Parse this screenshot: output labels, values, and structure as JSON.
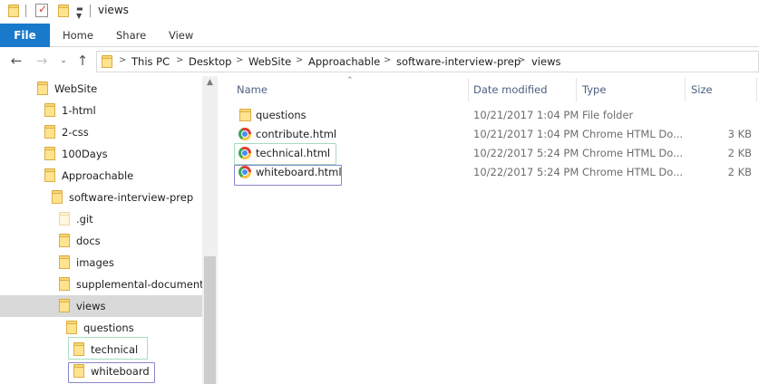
{
  "window": {
    "title": "views"
  },
  "ribbon": {
    "tabs": [
      "File",
      "Home",
      "Share",
      "View"
    ]
  },
  "address": {
    "crumbs": [
      "This PC",
      "Desktop",
      "WebSite",
      "Approachable",
      "software-interview-prep",
      "views"
    ]
  },
  "nav": {
    "items": [
      {
        "label": "WebSite"
      },
      {
        "label": "1-html"
      },
      {
        "label": "2-css"
      },
      {
        "label": "100Days"
      },
      {
        "label": "Approachable"
      },
      {
        "label": "software-interview-prep"
      },
      {
        "label": ".git"
      },
      {
        "label": "docs"
      },
      {
        "label": "images"
      },
      {
        "label": "supplemental-documentat"
      },
      {
        "label": "views"
      },
      {
        "label": "questions"
      },
      {
        "label": "technical"
      },
      {
        "label": "whiteboard"
      }
    ]
  },
  "columns": {
    "name": "Name",
    "date": "Date modified",
    "type": "Type",
    "size": "Size"
  },
  "files": [
    {
      "name": "questions",
      "date": "10/21/2017 1:04 PM",
      "type": "File folder",
      "size": "",
      "icon": "folder-icon"
    },
    {
      "name": "contribute.html",
      "date": "10/21/2017 1:04 PM",
      "type": "Chrome HTML Do...",
      "size": "3 KB",
      "icon": "chrome-icon"
    },
    {
      "name": "technical.html",
      "date": "10/22/2017 5:24 PM",
      "type": "Chrome HTML Do...",
      "size": "2 KB",
      "icon": "chrome-icon"
    },
    {
      "name": "whiteboard.html",
      "date": "10/22/2017 5:24 PM",
      "type": "Chrome HTML Do...",
      "size": "2 KB",
      "icon": "chrome-icon"
    }
  ],
  "colors": {
    "accent": "#1979ca",
    "selection": "#d9d9d9",
    "highlight_green": "#a9dcc0",
    "highlight_purple": "#8a86cc"
  }
}
